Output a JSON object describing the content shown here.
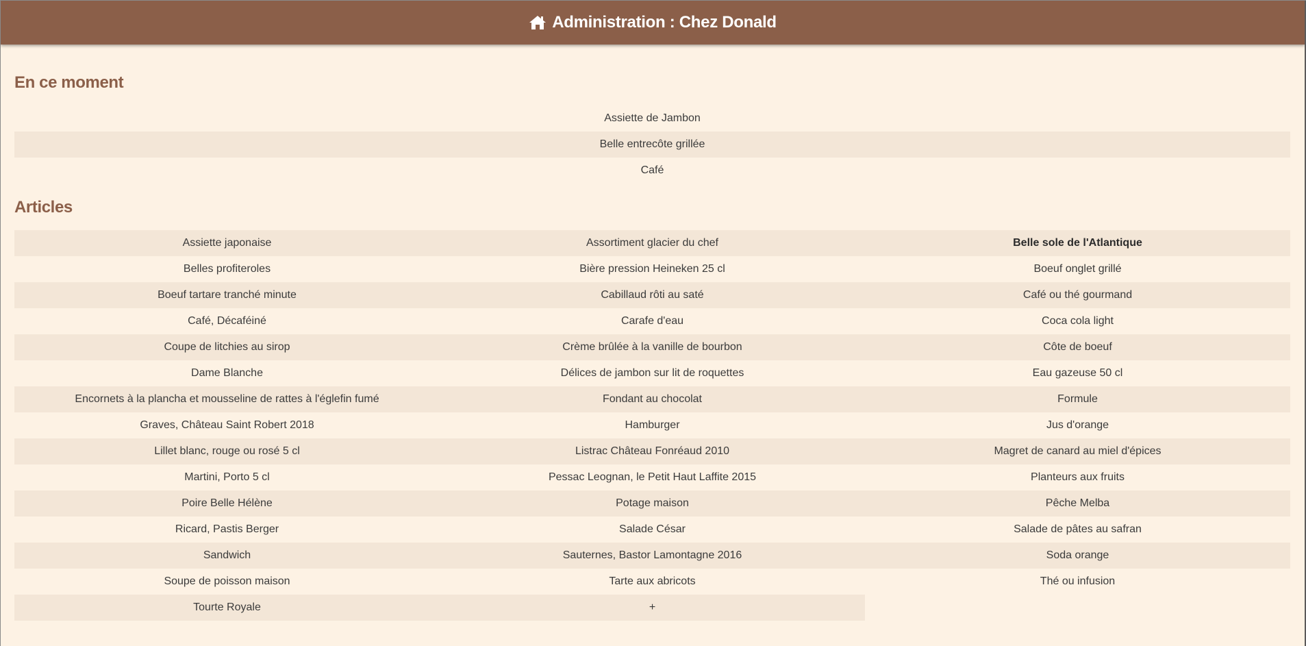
{
  "header": {
    "title": "Administration : Chez Donald",
    "icon": "home-icon",
    "background": "#8b5f49"
  },
  "current": {
    "title": "En ce moment",
    "items": [
      "Assiette de Jambon",
      "Belle entrecôte grillée",
      "Café"
    ]
  },
  "articles": {
    "title": "Articles",
    "items": [
      "Assiette japonaise",
      "Assortiment glacier du chef",
      "Belle sole de l'Atlantique",
      "Belles profiteroles",
      "Bière pression Heineken 25 cl",
      "Boeuf onglet grillé",
      "Boeuf tartare tranché minute",
      "Cabillaud rôti au saté",
      "Café ou thé gourmand",
      "Café, Décaféiné",
      "Carafe d'eau",
      "Coca cola light",
      "Coupe de litchies au sirop",
      "Crème brûlée à la vanille de bourbon",
      "Côte de boeuf",
      "Dame Blanche",
      "Délices de jambon sur lit de roquettes",
      "Eau gazeuse 50 cl",
      "Encornets à la plancha et mousseline de rattes à l'églefin fumé",
      "Fondant au chocolat",
      "Formule",
      "Graves, Château Saint Robert 2018",
      "Hamburger",
      "Jus d'orange",
      "Lillet blanc, rouge ou rosé 5 cl",
      "Listrac Château Fonréaud 2010",
      "Magret de canard au miel d'épices",
      "Martini, Porto 5 cl",
      "Pessac Leognan, le Petit Haut Laffite 2015",
      "Planteurs aux fruits",
      "Poire Belle Hélène",
      "Potage maison",
      "Pêche Melba",
      "Ricard, Pastis Berger",
      "Salade César",
      "Salade de pâtes au safran",
      "Sandwich",
      "Sauternes, Bastor Lamontagne 2016",
      "Soda orange",
      "Soupe de poisson maison",
      "Tarte aux abricots",
      "Thé ou infusion",
      "Tourte Royale",
      "+"
    ],
    "bold_item": "Belle sole de l'Atlantique"
  },
  "colors": {
    "accent": "#8b5f49",
    "page_background": "#fdf2e4",
    "stripe": "#f3e6d7",
    "text": "#3b3b3b"
  }
}
